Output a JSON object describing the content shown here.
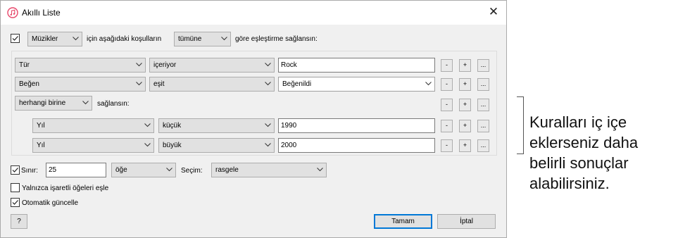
{
  "window": {
    "title": "Akıllı Liste",
    "close_symbol": "✕"
  },
  "match_row": {
    "media_type": "Müzikler",
    "text_before": "için aşağıdaki koşulların",
    "quantifier": "tümüne",
    "text_after": "göre eşleştirme sağlansın:"
  },
  "rules": [
    {
      "field": "Tür",
      "operator": "içeriyor",
      "value": "Rock"
    },
    {
      "field": "Beğen",
      "operator": "eşit",
      "value": "Beğenildi"
    }
  ],
  "nested": {
    "quantifier": "herhangi birine",
    "suffix": "sağlansın:",
    "rules": [
      {
        "field": "Yıl",
        "operator": "küçük",
        "value": "1990"
      },
      {
        "field": "Yıl",
        "operator": "büyük",
        "value": "2000"
      }
    ]
  },
  "rule_buttons": {
    "remove": "-",
    "add": "+",
    "more": "..."
  },
  "limit": {
    "label": "Sınır:",
    "value": "25",
    "unit": "öğe",
    "selection_label": "Seçim:",
    "selection": "rasgele"
  },
  "options": {
    "checked_only": "Yalnızca işaretli öğeleri eşle",
    "live_update": "Otomatik güncelle"
  },
  "footer": {
    "help": "?",
    "ok": "Tamam",
    "cancel": "İptal"
  },
  "callout": "Kuralları iç içe\neklerseniz daha\nbelirli sonuçlar\nalabilirsiniz."
}
